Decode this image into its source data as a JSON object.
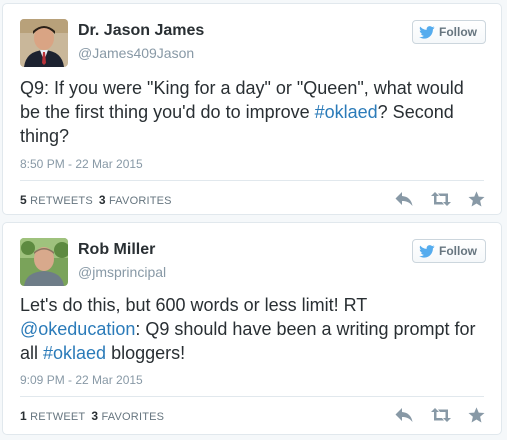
{
  "tweets": [
    {
      "name": "Dr. Jason James",
      "handle": "@James409Jason",
      "follow_label": "Follow",
      "text_pre": "Q9:  If you were \"King for a day\" or \"Queen\", what would be the first thing you'd do to improve ",
      "hashtag": "#oklaed",
      "text_post": "? Second thing?",
      "time": "8:50 PM - 22 Mar 2015",
      "retweet_count": "5",
      "retweet_label": "RETWEETS",
      "favorite_count": "3",
      "favorite_label": "FAVORITES"
    },
    {
      "name": "Rob Miller",
      "handle": "@jmsprincipal",
      "follow_label": "Follow",
      "text_pre": "Let's do this, but 600 words or less limit! RT ",
      "mention": "@okeducation",
      "text_mid": ": Q9 should have been a writing prompt for all ",
      "hashtag": "#oklaed",
      "text_post": " bloggers!",
      "time": "9:09 PM - 22 Mar 2015",
      "retweet_count": "1",
      "retweet_label": "RETWEET",
      "favorite_count": "3",
      "favorite_label": "FAVORITES"
    }
  ],
  "colors": {
    "link": "#2b7bb9",
    "twitter_blue": "#55acee",
    "muted": "#8899a6",
    "action_icon": "#8899a6"
  },
  "icons": {
    "follow": "twitter-bird-icon",
    "reply": "reply-icon",
    "retweet": "retweet-icon",
    "favorite": "star-icon"
  }
}
